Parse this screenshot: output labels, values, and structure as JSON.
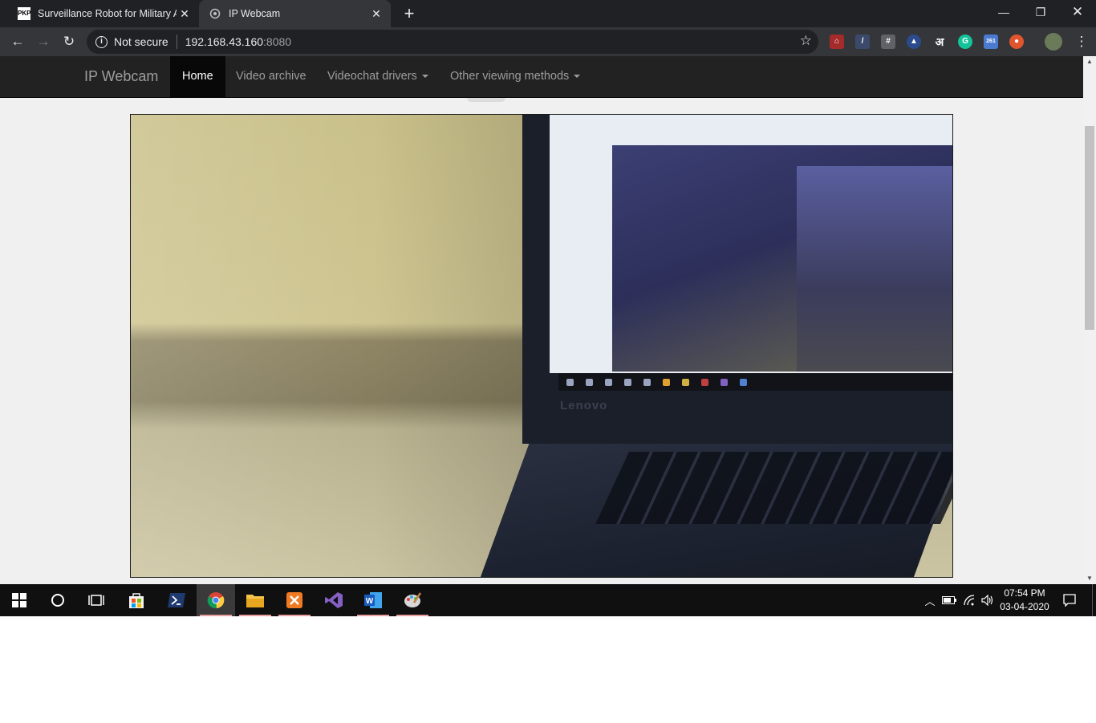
{
  "browser": {
    "tabs": [
      {
        "title": "Surveillance Robot for Military Ap",
        "favicon": "pkp-icon",
        "active": false
      },
      {
        "title": "IP Webcam",
        "favicon": "webcam-tab-icon",
        "active": true
      }
    ],
    "address": {
      "security_label": "Not secure",
      "host": "192.168.43.160",
      "port": ":8080"
    },
    "extension_labels": {
      "hindi": "अ",
      "counter": "261"
    }
  },
  "site": {
    "brand": "IP Webcam",
    "nav": {
      "home": "Home",
      "video_archive": "Video archive",
      "videochat_drivers": "Videochat drivers",
      "other_methods": "Other viewing methods"
    }
  },
  "feed": {
    "laptop_brand": "Lenovo"
  },
  "taskbar": {
    "apps": [
      "start",
      "search",
      "task-view",
      "store",
      "powershell",
      "chrome",
      "file-explorer",
      "xampp",
      "visual-studio",
      "word",
      "paint"
    ],
    "active_app": "chrome",
    "clock": {
      "time": "07:54 PM",
      "date": "03-04-2020"
    }
  },
  "colors": {
    "navbar": "#222222",
    "navbar_active": "#080808",
    "page_bg": "#f0f0f0",
    "chrome_dark": "#202124"
  }
}
